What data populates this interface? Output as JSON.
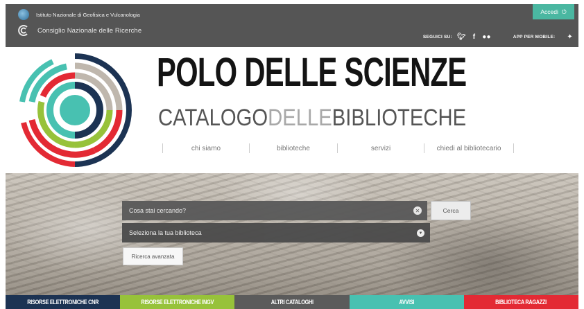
{
  "topbar": {
    "institute_1": "Istituto Nazionale di Geofisica e Vulcanologia",
    "institute_2": "Consiglio Nazionale delle Ricerche",
    "login_label": "Accedi",
    "follow_label": "SEGUICI SU:",
    "mobile_label": "APP PER MOBILE:",
    "social_icons": [
      "twitter-icon",
      "facebook-icon",
      "flickr-icon"
    ],
    "mobile_icons": [
      "apple-icon",
      "android-icon"
    ]
  },
  "header": {
    "title": "POLO DELLE SCIENZE",
    "subtitle_a": "CATALOGO",
    "subtitle_b": "DELLE",
    "subtitle_c": "BIBLIOTECHE"
  },
  "nav": {
    "items": [
      {
        "label": "chi siamo"
      },
      {
        "label": "biblioteche"
      },
      {
        "label": "servizi"
      },
      {
        "label": "chiedi al bibliotecario"
      }
    ]
  },
  "search": {
    "placeholder": "Cosa stai cercando?",
    "button": "Cerca",
    "library_select": "Seleziona la tua biblioteca",
    "advanced": "Ricerca avanzata"
  },
  "tabs": [
    {
      "label": "RISORSE ELETTRONICHE CNR",
      "color": "#1c3353"
    },
    {
      "label": "RISORSE ELETTRONICHE INGV",
      "color": "#97c23a"
    },
    {
      "label": "ALTRI CATALOGHI",
      "color": "#5b5b5b"
    },
    {
      "label": "AVVISI",
      "color": "#48c1b1"
    },
    {
      "label": "BIBLIOTECA RAGAZZI",
      "color": "#e32a34"
    }
  ],
  "colors": {
    "accent": "#4ab7a1",
    "topbar": "#555555"
  }
}
